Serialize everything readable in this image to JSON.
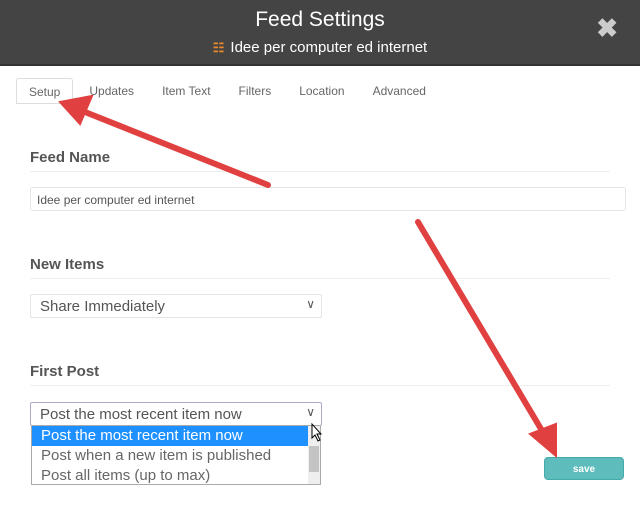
{
  "header": {
    "title": "Feed Settings",
    "subtitle": "Idee per computer ed internet",
    "close_icon": "close-x-icon",
    "feed_icon": "rss-icon"
  },
  "tabs": [
    {
      "label": "Setup",
      "active": true
    },
    {
      "label": "Updates"
    },
    {
      "label": "Item Text"
    },
    {
      "label": "Filters"
    },
    {
      "label": "Location"
    },
    {
      "label": "Advanced"
    }
  ],
  "feed_name": {
    "heading": "Feed Name",
    "value": "Idee per computer ed internet"
  },
  "new_items": {
    "heading": "New Items",
    "selected": "Share Immediately"
  },
  "first_post": {
    "heading": "First Post",
    "selected": "Post the most recent item now",
    "options": [
      "Post the most recent item now",
      "Post when a new item is published",
      "Post all items (up to max)"
    ]
  },
  "save_label": "save",
  "colors": {
    "header": "#444444",
    "accent": "#5fbcbc",
    "highlight": "#1e90ff",
    "annotation_arrow": "#e04040"
  }
}
